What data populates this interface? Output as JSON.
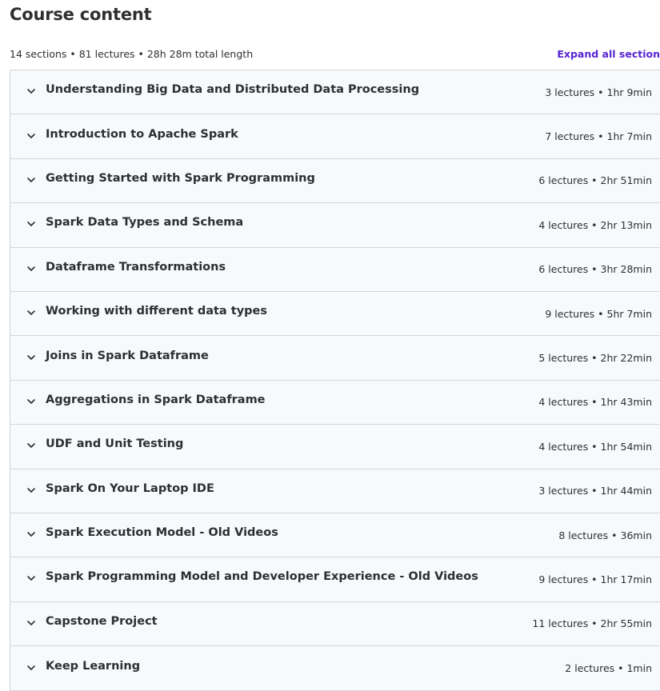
{
  "header": {
    "title": "Course content",
    "summary": "14 sections • 81 lectures • 28h 28m total length",
    "expand_all_label": "Expand all section"
  },
  "colors": {
    "accent": "#5624d0",
    "section_bg": "#f7f9fa",
    "border": "#d1d7dc",
    "text": "#2d2f31"
  },
  "sections": [
    {
      "title": "Understanding Big Data and Distributed Data Processing",
      "meta": "3 lectures • 1hr 9min",
      "icon": "chevron-down-icon"
    },
    {
      "title": "Introduction to Apache Spark",
      "meta": "7 lectures • 1hr 7min",
      "icon": "chevron-down-icon"
    },
    {
      "title": "Getting Started with Spark Programming",
      "meta": "6 lectures • 2hr 51min",
      "icon": "chevron-down-icon"
    },
    {
      "title": "Spark Data Types and Schema",
      "meta": "4 lectures • 2hr 13min",
      "icon": "chevron-down-icon"
    },
    {
      "title": "Dataframe Transformations",
      "meta": "6 lectures • 3hr 28min",
      "icon": "chevron-down-icon"
    },
    {
      "title": "Working with different data types",
      "meta": "9 lectures • 5hr 7min",
      "icon": "chevron-down-icon"
    },
    {
      "title": "Joins in Spark Dataframe",
      "meta": "5 lectures • 2hr 22min",
      "icon": "chevron-down-icon"
    },
    {
      "title": "Aggregations in Spark Dataframe",
      "meta": "4 lectures • 1hr 43min",
      "icon": "chevron-down-icon"
    },
    {
      "title": "UDF and Unit Testing",
      "meta": "4 lectures • 1hr 54min",
      "icon": "chevron-down-icon"
    },
    {
      "title": "Spark On Your Laptop IDE",
      "meta": "3 lectures • 1hr 44min",
      "icon": "chevron-down-icon"
    },
    {
      "title": "Spark Execution Model - Old Videos",
      "meta": "8 lectures • 36min",
      "icon": "chevron-down-icon"
    },
    {
      "title": "Spark Programming Model and Developer Experience - Old Videos",
      "meta": "9 lectures • 1hr 17min",
      "icon": "chevron-down-icon"
    },
    {
      "title": "Capstone Project",
      "meta": "11 lectures • 2hr 55min",
      "icon": "chevron-down-icon"
    },
    {
      "title": "Keep Learning",
      "meta": "2 lectures • 1min",
      "icon": "chevron-down-icon"
    }
  ]
}
